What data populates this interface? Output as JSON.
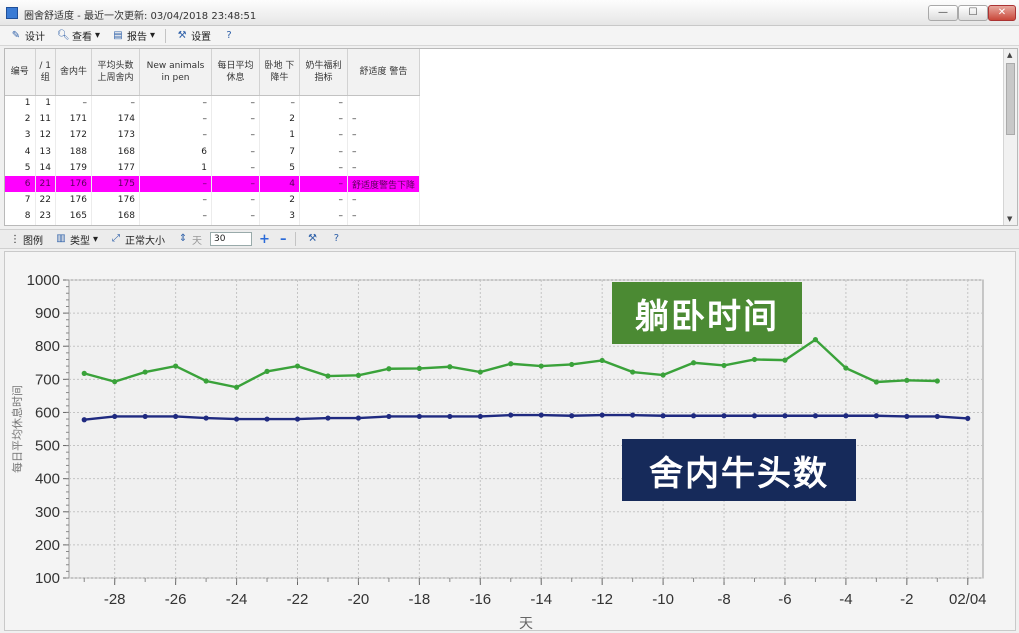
{
  "window": {
    "title": "圈舍舒适度 - 最近一次更新: 03/04/2018 23:48:51",
    "min_label": "—",
    "max_label": "☐",
    "close_label": "✕"
  },
  "toolbar_top": {
    "design_label": "设计",
    "view_label": "查看",
    "report_label": "报告",
    "settings_label": "设置"
  },
  "grid": {
    "headers": [
      "编号",
      "/ 1 组",
      "舍内牛",
      "平均头数 上周舍内",
      "New animals in pen",
      "每日平均 休息",
      "卧地 下降牛",
      "奶牛福利 指标",
      "舒适度 警告"
    ],
    "rows": [
      [
        "1",
        "1",
        "–",
        "–",
        "–",
        "–",
        "–",
        "–",
        ""
      ],
      [
        "2",
        "11",
        "171",
        "174",
        "–",
        "–",
        "2",
        "–",
        "–"
      ],
      [
        "3",
        "12",
        "172",
        "173",
        "–",
        "–",
        "1",
        "–",
        "–"
      ],
      [
        "4",
        "13",
        "188",
        "168",
        "6",
        "–",
        "7",
        "–",
        "–"
      ],
      [
        "5",
        "14",
        "179",
        "177",
        "1",
        "–",
        "5",
        "–",
        "–"
      ],
      [
        "6",
        "21",
        "176",
        "175",
        "–",
        "–",
        "4",
        "–",
        "舒适度警告下降"
      ],
      [
        "7",
        "22",
        "176",
        "176",
        "–",
        "–",
        "2",
        "–",
        "–"
      ],
      [
        "8",
        "23",
        "165",
        "168",
        "–",
        "–",
        "3",
        "–",
        "–"
      ]
    ],
    "highlight_row_index": 5
  },
  "toolbar_mid": {
    "legend_label": "图例",
    "type_label": "类型",
    "normal_size_label": "正常大小",
    "day_label": "天",
    "days_value": "30",
    "plus_label": "+",
    "minus_label": "–"
  },
  "overlays": {
    "green_label": "躺卧时间",
    "navy_label": "舍内牛头数"
  },
  "chart_data": {
    "type": "line",
    "xlabel": "天",
    "ylabel": "每日平均休息时间",
    "ylim": [
      100,
      1000
    ],
    "yticks": [
      100,
      200,
      300,
      400,
      500,
      600,
      700,
      800,
      900,
      1000
    ],
    "xlim": [
      -29.5,
      0.5
    ],
    "xticks": [
      {
        "v": -28,
        "label": "-28"
      },
      {
        "v": -26,
        "label": "-26"
      },
      {
        "v": -24,
        "label": "-24"
      },
      {
        "v": -22,
        "label": "-22"
      },
      {
        "v": -20,
        "label": "-20"
      },
      {
        "v": -18,
        "label": "-18"
      },
      {
        "v": -16,
        "label": "-16"
      },
      {
        "v": -14,
        "label": "-14"
      },
      {
        "v": -12,
        "label": "-12"
      },
      {
        "v": -10,
        "label": "-10"
      },
      {
        "v": -8,
        "label": "-8"
      },
      {
        "v": -6,
        "label": "-6"
      },
      {
        "v": -4,
        "label": "-4"
      },
      {
        "v": -2,
        "label": "-2"
      },
      {
        "v": 0,
        "label": "02/04"
      }
    ],
    "grid": true,
    "colors": {
      "resting": "#3aa23a",
      "cows": "#1f2a80"
    },
    "series": [
      {
        "key": "resting",
        "x": [
          -29,
          -28,
          -27,
          -26,
          -25,
          -24,
          -23,
          -22,
          -21,
          -20,
          -19,
          -18,
          -17,
          -16,
          -15,
          -14,
          -13,
          -12,
          -11,
          -10,
          -9,
          -8,
          -7,
          -6,
          -5,
          -4,
          -3,
          -2,
          -1
        ],
        "values": [
          718,
          693,
          722,
          740,
          695,
          676,
          724,
          740,
          710,
          712,
          732,
          733,
          738,
          722,
          747,
          740,
          745,
          757,
          722,
          713,
          750,
          742,
          760,
          758,
          820,
          734,
          692,
          697,
          695
        ]
      },
      {
        "key": "cows",
        "x": [
          -29,
          -28,
          -27,
          -26,
          -25,
          -24,
          -23,
          -22,
          -21,
          -20,
          -19,
          -18,
          -17,
          -16,
          -15,
          -14,
          -13,
          -12,
          -11,
          -10,
          -9,
          -8,
          -7,
          -6,
          -5,
          -4,
          -3,
          -2,
          -1,
          0
        ],
        "values": [
          578,
          588,
          588,
          588,
          583,
          580,
          580,
          580,
          583,
          583,
          588,
          588,
          588,
          588,
          592,
          592,
          590,
          592,
          592,
          590,
          590,
          590,
          590,
          590,
          590,
          590,
          590,
          588,
          588,
          582
        ]
      }
    ]
  }
}
